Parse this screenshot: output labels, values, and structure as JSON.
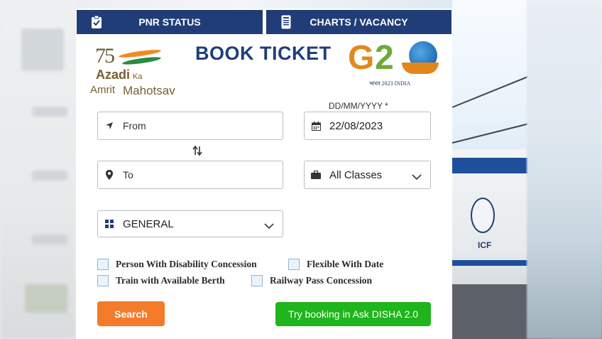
{
  "tabs": [
    {
      "label": "PNR STATUS",
      "icon": "clipboard-check-icon"
    },
    {
      "label": "CHARTS / VACANCY",
      "icon": "document-list-icon"
    }
  ],
  "header": {
    "title": "BOOK TICKET",
    "azadi_logo": {
      "number": "75",
      "line1": "Azadi",
      "line2": "Ka",
      "line3": "Amrit",
      "line4": "Mahotsav"
    },
    "g20_logo": {
      "text": "G20",
      "subtitle": "भारत 2023 INDIA"
    }
  },
  "form": {
    "from": {
      "placeholder": "From",
      "icon": "location-arrow-icon"
    },
    "to": {
      "placeholder": "To",
      "icon": "map-pin-icon"
    },
    "date": {
      "label": "DD/MM/YYYY *",
      "value": "22/08/2023",
      "icon": "calendar-icon"
    },
    "classes": {
      "value": "All Classes",
      "icon": "briefcase-icon"
    },
    "quota": {
      "value": "GENERAL",
      "icon": "grid-icon"
    },
    "swap_icon": "swap-arrows-icon"
  },
  "checkboxes": [
    {
      "label": "Person With Disability Concession",
      "checked": false
    },
    {
      "label": "Flexible With Date",
      "checked": false
    },
    {
      "label": "Train with Available Berth",
      "checked": false
    },
    {
      "label": "Railway Pass Concession",
      "checked": false
    }
  ],
  "buttons": {
    "search": "Search",
    "disha": "Try booking in Ask DISHA 2.0"
  },
  "colors": {
    "navy": "#213d77",
    "orange": "#f47b2a",
    "green": "#1fb51c"
  }
}
